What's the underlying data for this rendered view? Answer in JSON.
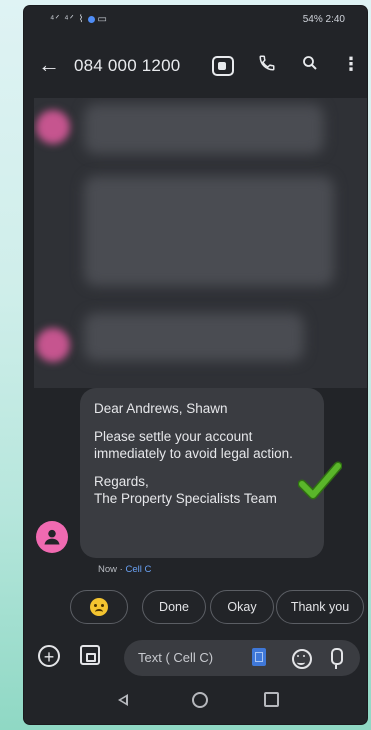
{
  "status_bar": {
    "left_icons": "⁴ᐟ ⁴ᐟ ⌇",
    "right_text": "54%  2:40"
  },
  "app_bar": {
    "title": "084 000 1200"
  },
  "message": {
    "greeting": "Dear Andrews, Shawn",
    "body": "Please settle your account immediately to avoid legal action.",
    "signoff": "Regards,\nThe Property Specialists Team",
    "time": "Now",
    "carrier": "Cell C"
  },
  "smart_replies": [
    "Done",
    "Okay",
    "Thank you"
  ],
  "composer": {
    "placeholder": "Text ( Cell C)"
  },
  "colors": {
    "accent_blue": "#6aa1f3",
    "avatar_pink": "#f06ab1",
    "check_green": "#5ab62a"
  },
  "icons": [
    "back-arrow-icon",
    "video-call-icon",
    "phone-icon",
    "search-icon",
    "more-vert-icon",
    "checkmark-icon",
    "person-icon",
    "add-icon",
    "gallery-icon",
    "sim-card-icon",
    "emoji-icon",
    "mic-icon"
  ]
}
